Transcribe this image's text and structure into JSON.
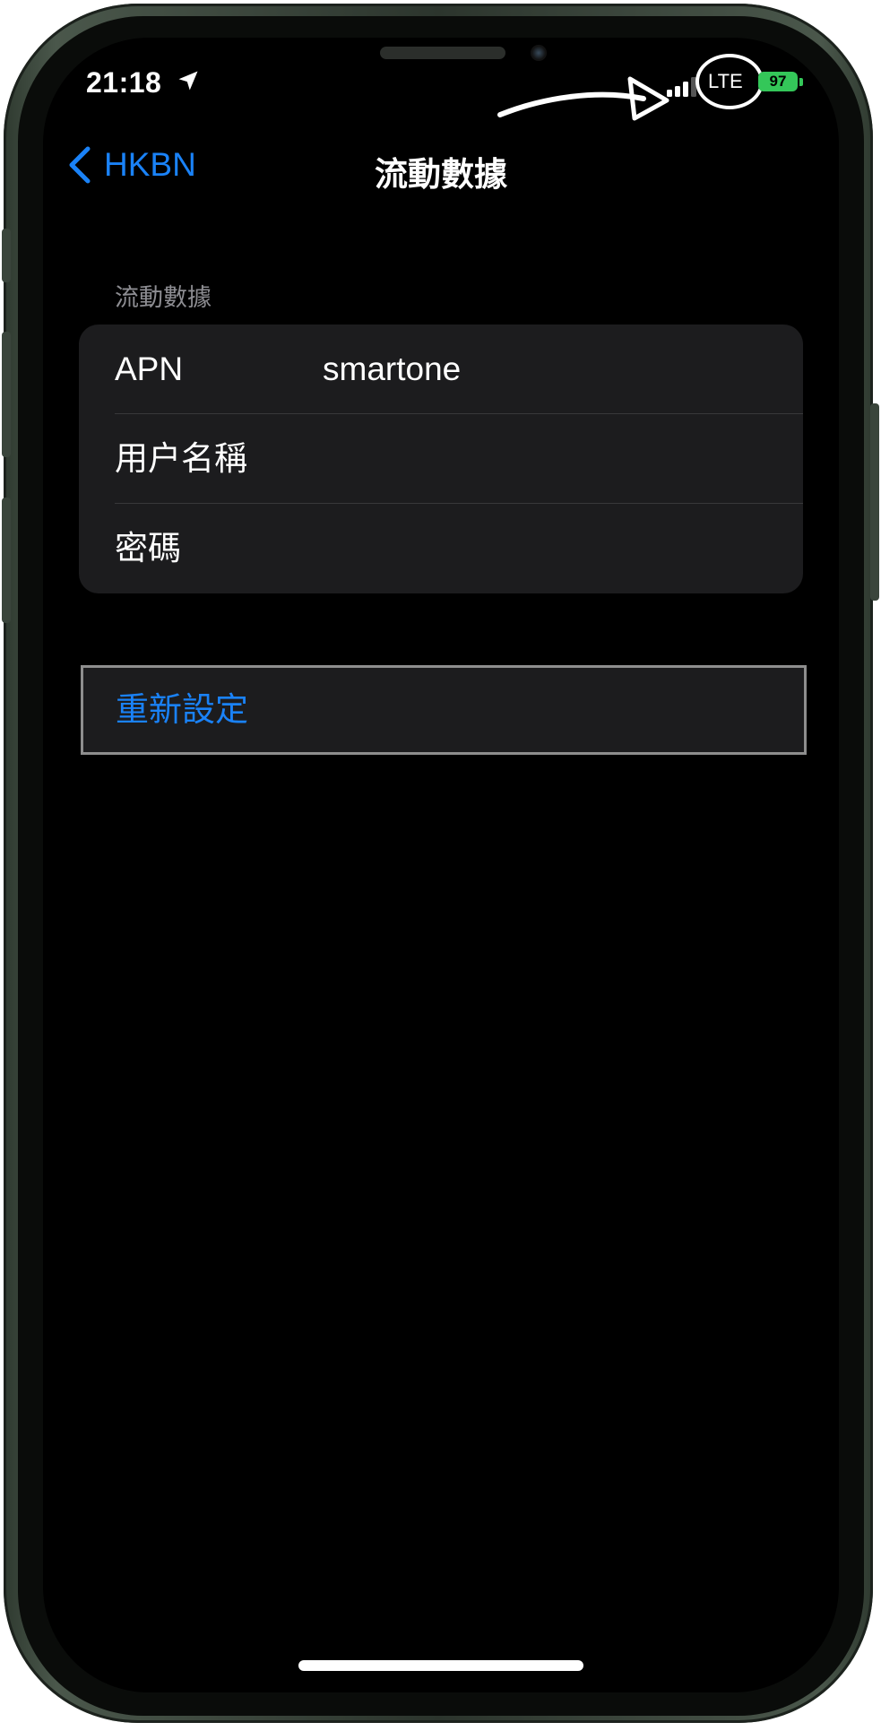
{
  "status_bar": {
    "time": "21:18",
    "network_type": "LTE",
    "battery_level": "97",
    "battery_color": "#34c759"
  },
  "nav": {
    "back_label": "HKBN",
    "title": "流動數據"
  },
  "cellular_section": {
    "header": "流動數據",
    "rows": [
      {
        "label": "APN",
        "value": "smartone"
      },
      {
        "label": "用户名稱",
        "value": ""
      },
      {
        "label": "密碼",
        "value": ""
      }
    ]
  },
  "reset": {
    "label": "重新設定"
  },
  "colors": {
    "accent": "#1a82f7",
    "group_background": "#1c1c1e",
    "section_header": "#8d8d92"
  },
  "icons": [
    "location-arrow-icon",
    "cellular-signal-icon",
    "battery-icon",
    "chevron-left-icon"
  ]
}
